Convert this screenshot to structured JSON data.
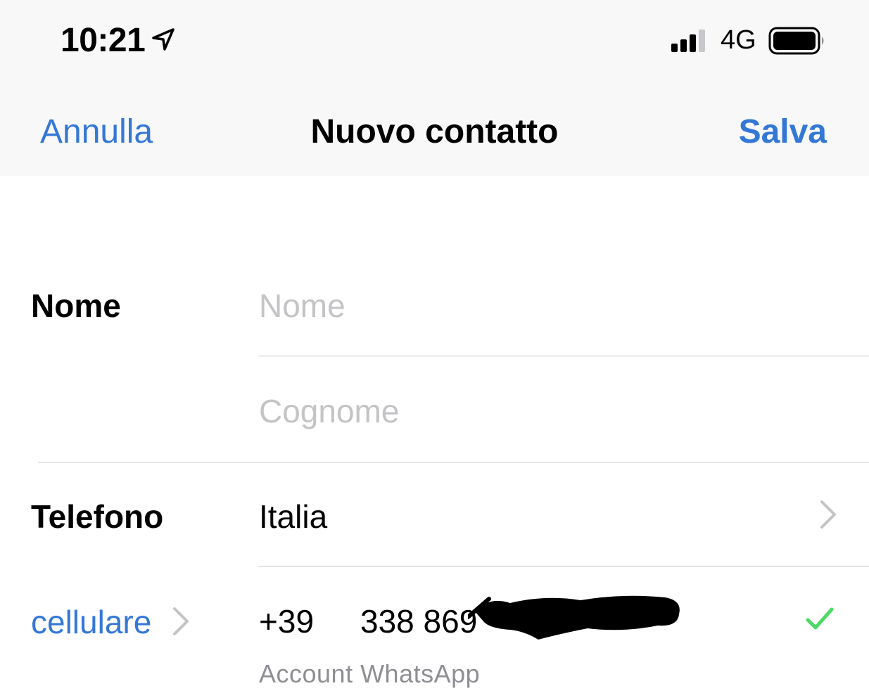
{
  "status_bar": {
    "time": "10:21",
    "network": "4G",
    "icons": [
      "location-arrow-icon",
      "signal-bars-icon",
      "battery-icon"
    ]
  },
  "nav": {
    "cancel_label": "Annulla",
    "title": "Nuovo contatto",
    "save_label": "Salva",
    "accent_color": "#3478d6"
  },
  "form": {
    "name_section_label": "Nome",
    "first_name_placeholder": "Nome",
    "last_name_placeholder": "Cognome",
    "phone_section_label": "Telefono",
    "country": "Italia",
    "phone_type_label": "cellulare",
    "country_code": "+39",
    "phone_number_visible": "338 869",
    "phone_note": "Account WhatsApp",
    "verified_color": "#4cd964"
  }
}
